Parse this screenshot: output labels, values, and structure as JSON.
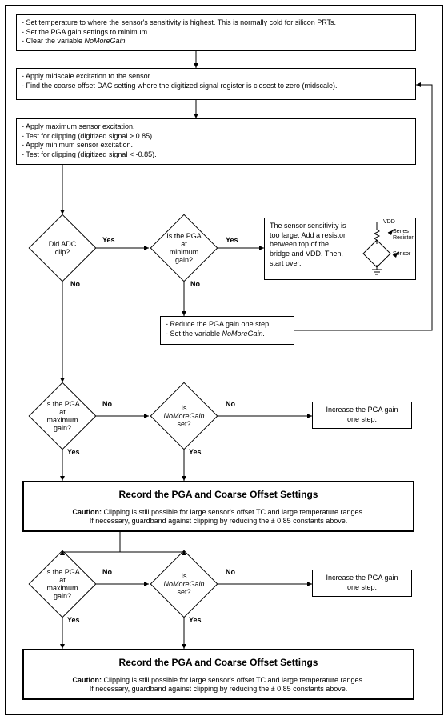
{
  "chart_data": {
    "type": "flowchart",
    "nodes": [
      {
        "id": "n1",
        "type": "process",
        "text": [
          "- Set temperature to where the sensor's sensitivity is highest. This is normally cold for silicon PRTs.",
          "- Set the PGA gain settings to minimum.",
          "- Clear the variable NoMoreGain."
        ]
      },
      {
        "id": "n2",
        "type": "process",
        "text": [
          "- Apply midscale excitation to the sensor.",
          "- Find the coarse offset DAC setting where the digitized signal register is closest to zero (midscale)."
        ]
      },
      {
        "id": "n3",
        "type": "process",
        "text": [
          "- Apply maximum sensor excitation.",
          "- Test for clipping (digitized signal > 0.85).",
          "- Apply minimum sensor excitation.",
          "- Test for clipping (digitized signal < -0.85)."
        ]
      },
      {
        "id": "d1",
        "type": "decision",
        "text": "Did ADC clip?"
      },
      {
        "id": "d2",
        "type": "decision",
        "text": "Is the PGA at minimum gain?"
      },
      {
        "id": "n4",
        "type": "process",
        "text": [
          "The sensor sensitivity is too large. Add a resistor between top of the bridge and VDD. Then, start over."
        ]
      },
      {
        "id": "n5",
        "type": "process",
        "text": [
          "- Reduce the PGA gain one step.",
          "- Set the variable NoMoreGain."
        ]
      },
      {
        "id": "d3",
        "type": "decision",
        "text": "Is the PGA at maximum gain?"
      },
      {
        "id": "d4",
        "type": "decision",
        "text": "Is NoMoreGain set?"
      },
      {
        "id": "n6",
        "type": "process",
        "text": [
          "Increase the PGA gain one step."
        ]
      },
      {
        "id": "n7",
        "type": "result",
        "title": "Record the PGA and Coarse Offset Settings",
        "caution": "Caution: Clipping is still possible for large sensor's offset TC and large temperature ranges. If necessary, guardband against clipping by reducing the ± 0.85 constants above."
      },
      {
        "id": "d5",
        "type": "decision",
        "text": "Is the PGA at maximum gain?"
      },
      {
        "id": "d6",
        "type": "decision",
        "text": "Is NoMoreGain set?"
      },
      {
        "id": "n8",
        "type": "process",
        "text": [
          "Increase the PGA gain one step."
        ]
      },
      {
        "id": "n9",
        "type": "result",
        "title": "Record the PGA and Coarse Offset Settings",
        "caution": "Caution: Clipping is still possible for large sensor's offset TC and large temperature ranges. If necessary, guardband against clipping by reducing the ± 0.85 constants above."
      }
    ],
    "edges": [
      {
        "from": "n1",
        "to": "n2"
      },
      {
        "from": "n2",
        "to": "n3"
      },
      {
        "from": "n3",
        "to": "d1"
      },
      {
        "from": "d1",
        "to": "d2",
        "label": "Yes"
      },
      {
        "from": "d1",
        "to": "d3",
        "label": "No"
      },
      {
        "from": "d2",
        "to": "n4",
        "label": "Yes"
      },
      {
        "from": "d2",
        "to": "n5",
        "label": "No"
      },
      {
        "from": "n5",
        "to": "n2"
      },
      {
        "from": "d3",
        "to": "d4",
        "label": "No"
      },
      {
        "from": "d3",
        "to": "n7",
        "label": "Yes"
      },
      {
        "from": "d4",
        "to": "n6",
        "label": "No"
      },
      {
        "from": "d4",
        "to": "n7",
        "label": "Yes"
      },
      {
        "from": "d5",
        "to": "d6",
        "label": "No"
      },
      {
        "from": "d5",
        "to": "n9",
        "label": "Yes"
      },
      {
        "from": "d6",
        "to": "n8",
        "label": "No"
      },
      {
        "from": "d6",
        "to": "n9",
        "label": "Yes"
      }
    ]
  },
  "labels": {
    "yes": "Yes",
    "no": "No",
    "vdd": "VDD",
    "series": "Series",
    "resistor": "Resistor",
    "sensor": "Sensor"
  },
  "n1": {
    "l0": "- Set temperature to where the sensor's sensitivity is highest. This is normally cold for silicon PRTs.",
    "l1": "- Set the PGA gain settings to minimum.",
    "l2": "- Clear the variable ",
    "l2b": "NoMoreGain."
  },
  "n2": {
    "l0": "- Apply midscale excitation to the sensor.",
    "l1": "- Find the coarse offset DAC setting where the digitized signal register is closest to zero (midscale)."
  },
  "n3": {
    "l0": "- Apply maximum sensor excitation.",
    "l1": "- Test for clipping (digitized signal > 0.85).",
    "l2": "- Apply minimum sensor excitation.",
    "l3": "- Test for clipping (digitized signal < -0.85)."
  },
  "d1": {
    "t": "Did ADC clip?"
  },
  "d2": {
    "t0": "Is the PGA at",
    "t1": "minimum gain?"
  },
  "n4": {
    "t": "The sensor sensitivity is too large. Add a resistor between top of the bridge and VDD. Then, start over."
  },
  "n5": {
    "l0": "- Reduce the PGA gain one step.",
    "l1": "- Set the variable ",
    "l1b": "NoMoreGain."
  },
  "d3": {
    "t0": "Is the PGA at",
    "t1": "maximum gain?"
  },
  "d4": {
    "t0": "Is ",
    "t0b": "NoMoreGain",
    "t1": "set?"
  },
  "n6": {
    "t0": "Increase the PGA gain",
    "t1": "one step."
  },
  "n7": {
    "title": "Record the PGA and Coarse Offset Settings",
    "c0": "Caution:",
    "c1": " Clipping is still possible for large sensor's offset TC and large temperature ranges.",
    "c2": "If necessary, guardband against clipping by reducing the ± 0.85 constants above."
  }
}
